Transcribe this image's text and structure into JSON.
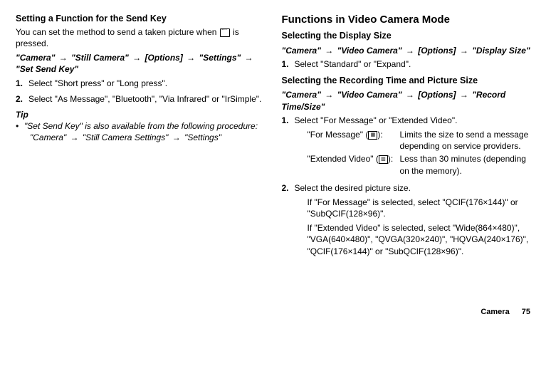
{
  "left": {
    "h1": "Setting a Function for the Send Key",
    "intro_a": "You can set the method to send a taken picture when ",
    "intro_b": " is pressed.",
    "path": [
      "\"Camera\"",
      "\"Still Camera\"",
      "[Options]",
      "\"Settings\"",
      "\"Set Send Key\""
    ],
    "steps": [
      {
        "n": "1.",
        "t": "Select \"Short press\" or \"Long press\"."
      },
      {
        "n": "2.",
        "t": "Select \"As Message\", \"Bluetooth\", \"Via Infrared\" or \"IrSimple\"."
      }
    ],
    "tip_label": "Tip",
    "tip_main": "\"Set Send Key\" is also available from the following procedure:",
    "tip_path": [
      "\"Camera\"",
      "\"Still Camera Settings\"",
      "\"Settings\""
    ]
  },
  "right": {
    "title": "Functions in Video Camera Mode",
    "s1": {
      "h": "Selecting the Display Size",
      "path": [
        "\"Camera\"",
        "\"Video Camera\"",
        "[Options]",
        "\"Display Size\""
      ],
      "step1n": "1.",
      "step1t": "Select \"Standard\" or \"Expand\"."
    },
    "s2": {
      "h": "Selecting the Recording Time and Picture Size",
      "path": [
        "\"Camera\"",
        "\"Video Camera\"",
        "[Options]",
        "\"Record Time/Size\""
      ],
      "step1n": "1.",
      "step1t": "Select \"For Message\" or \"Extended Video\".",
      "def1_term_a": "\"For Message\" (",
      "def1_term_b": "):",
      "def1_def": "Limits the size to send a message depending on service providers.",
      "def2_term_a": "\"Extended Video\" (",
      "def2_term_b": "):",
      "def2_def": "Less than 30 minutes (depending on the memory).",
      "step2n": "2.",
      "step2t": "Select the desired picture size.",
      "step2_p1": "If \"For Message\" is selected, select \"QCIF(176×144)\" or \"SubQCIF(128×96)\".",
      "step2_p2": "If \"Extended Video\" is selected, select \"Wide(864×480)\", \"VGA(640×480)\", \"QVGA(320×240)\", \"HQVGA(240×176)\", \"QCIF(176×144)\" or \"SubQCIF(128×96)\"."
    }
  },
  "footer": {
    "section": "Camera",
    "page": "75"
  }
}
